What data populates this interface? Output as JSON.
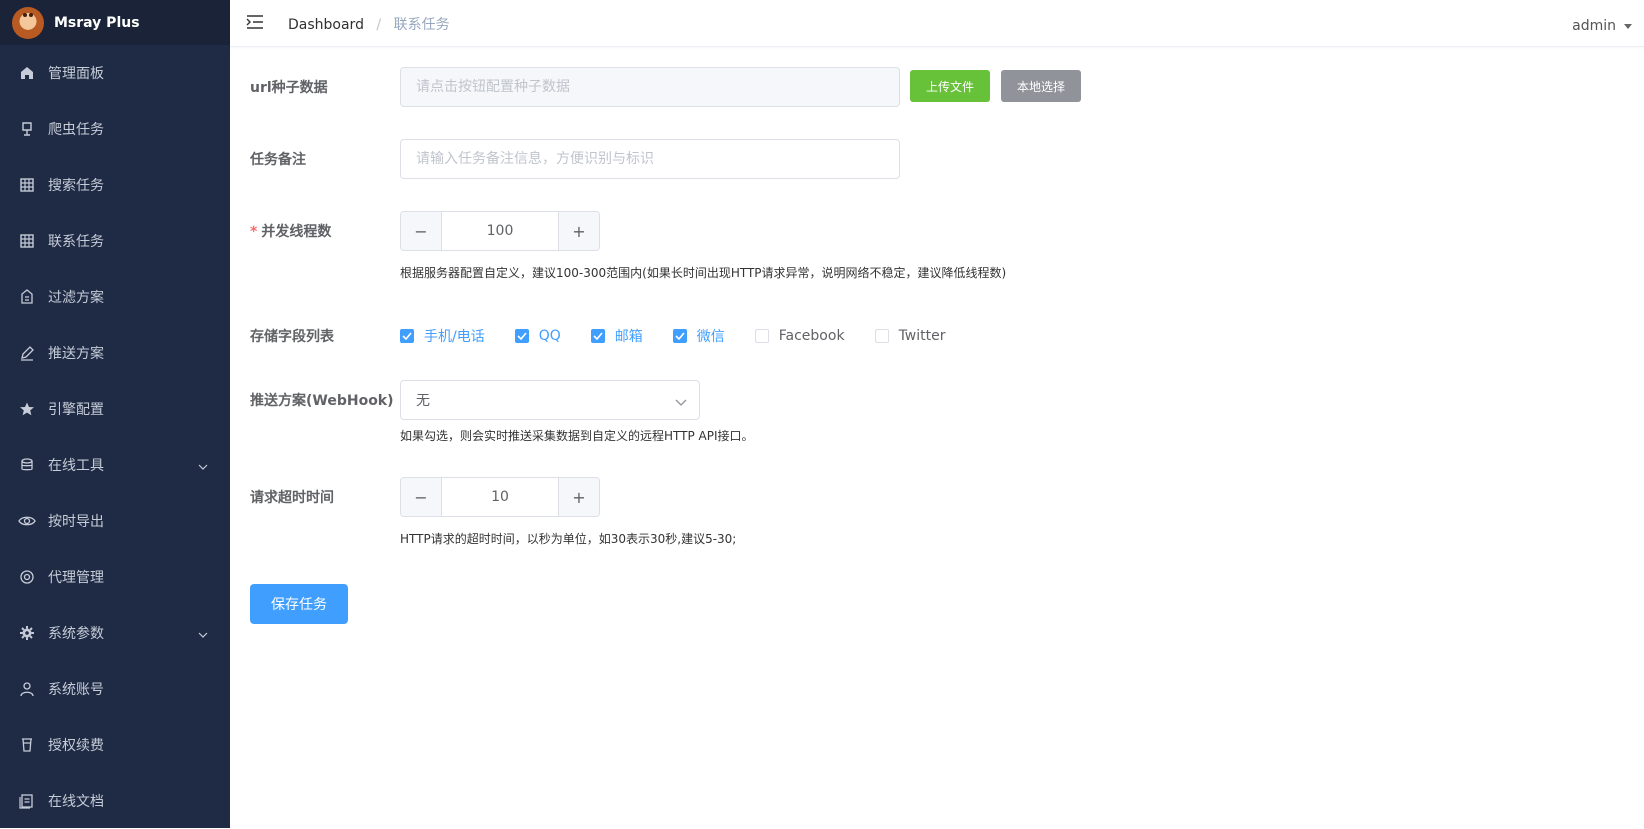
{
  "app": {
    "title": "Msray Plus"
  },
  "sidebar": {
    "items": [
      {
        "label": "管理面板",
        "icon": "home-icon"
      },
      {
        "label": "爬虫任务",
        "icon": "lamp-icon"
      },
      {
        "label": "搜索任务",
        "icon": "grid-icon"
      },
      {
        "label": "联系任务",
        "icon": "grid-icon"
      },
      {
        "label": "过滤方案",
        "icon": "building-icon"
      },
      {
        "label": "推送方案",
        "icon": "pen-icon"
      },
      {
        "label": "引擎配置",
        "icon": "star-icon"
      },
      {
        "label": "在线工具",
        "icon": "coins-icon",
        "expandable": true
      },
      {
        "label": "按时导出",
        "icon": "eye-icon"
      },
      {
        "label": "代理管理",
        "icon": "settings-icon"
      },
      {
        "label": "系统参数",
        "icon": "gear-icon",
        "expandable": true
      },
      {
        "label": "系统账号",
        "icon": "user-icon"
      },
      {
        "label": "授权续费",
        "icon": "cup-icon"
      },
      {
        "label": "在线文档",
        "icon": "document-icon"
      }
    ]
  },
  "header": {
    "breadcrumb": {
      "root": "Dashboard",
      "separator": "/",
      "current": "联系任务"
    },
    "user": "admin"
  },
  "form": {
    "seed": {
      "label": "url种子数据",
      "placeholder": "请点击按钮配置种子数据",
      "upload_button": "上传文件",
      "local_button": "本地选择"
    },
    "remark": {
      "label": "任务备注",
      "placeholder": "请输入任务备注信息，方便识别与标识"
    },
    "threads": {
      "required_mark": "*",
      "label": "并发线程数",
      "value": "100",
      "hint": "根据服务器配置自定义，建议100-300范围内(如果长时间出现HTTP请求异常，说明网络不稳定，建议降低线程数)"
    },
    "fields": {
      "label": "存储字段列表",
      "options": [
        {
          "label": "手机/电话",
          "checked": true
        },
        {
          "label": "QQ",
          "checked": true
        },
        {
          "label": "邮箱",
          "checked": true
        },
        {
          "label": "微信",
          "checked": true
        },
        {
          "label": "Facebook",
          "checked": false
        },
        {
          "label": "Twitter",
          "checked": false
        }
      ]
    },
    "webhook": {
      "label": "推送方案(WebHook)",
      "value": "无",
      "hint": "如果勾选，则会实时推送采集数据到自定义的远程HTTP API接口。"
    },
    "timeout": {
      "label": "请求超时时间",
      "value": "10",
      "hint": "HTTP请求的超时时间，以秒为单位，如30表示30秒,建议5-30;"
    },
    "save_button": "保存任务"
  },
  "colors": {
    "sidebar_bg": "#1f2a44",
    "primary": "#409eff",
    "success": "#67c23a",
    "info": "#909399"
  }
}
